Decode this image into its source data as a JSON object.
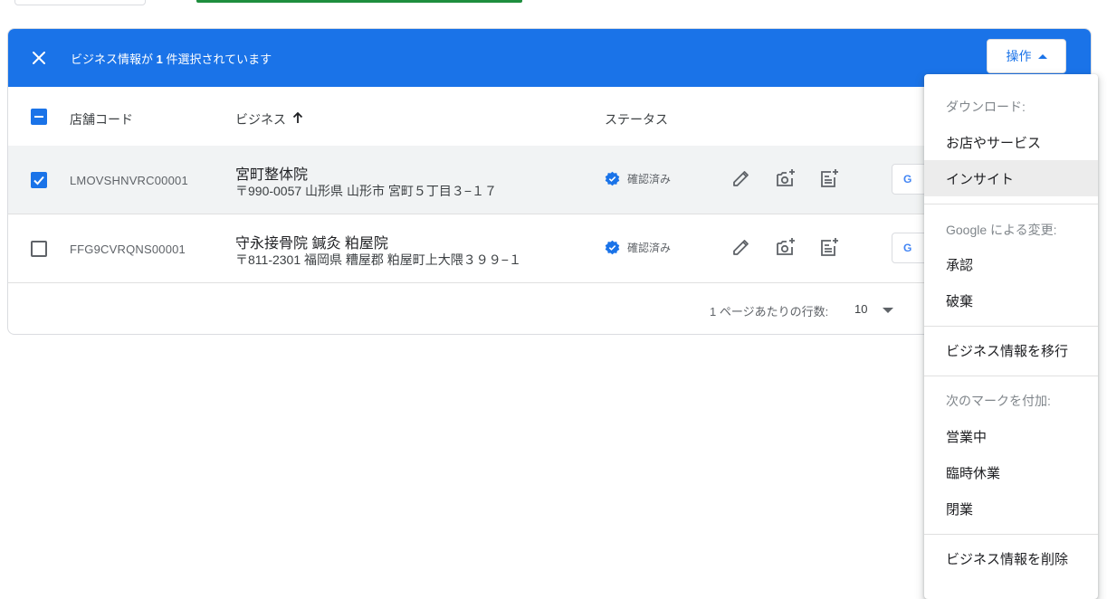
{
  "selection_bar": {
    "text_before": "ビジネス情報が ",
    "count": "1",
    "text_after": " 件選択されています",
    "actions_label": "操作"
  },
  "table": {
    "columns": {
      "store_code": "店舗コード",
      "business": "ビジネス",
      "status": "ステータス"
    },
    "rows": [
      {
        "code": "LMOVSHNVRC00001",
        "name": "宮町整体院",
        "address": "〒990-0057 山形県 山形市 宮町５丁目３−１７",
        "status": "確認済み",
        "checked": true
      },
      {
        "code": "FFG9CVRQNS00001",
        "name": "守永接骨院 鍼灸 粕屋院",
        "address": "〒811-2301 福岡県 糟屋郡 粕屋町上大隈３９９−１",
        "status": "確認済み",
        "checked": false
      }
    ]
  },
  "pagination": {
    "rows_per_page_label": "1 ページあたりの行数:",
    "rows_per_page_value": "10"
  },
  "menu": {
    "download_header": "ダウンロード:",
    "download_items": [
      "お店やサービス",
      "インサイト"
    ],
    "google_changes_header": "Google による変更:",
    "google_changes_items": [
      "承認",
      "破棄"
    ],
    "transfer": "ビジネス情報を移行",
    "mark_header": "次のマークを付加:",
    "mark_items": [
      "営業中",
      "臨時休業",
      "閉業"
    ],
    "delete": "ビジネス情報を削除"
  },
  "colors": {
    "accent": "#1a73e8",
    "green": "#1e8e3e"
  }
}
